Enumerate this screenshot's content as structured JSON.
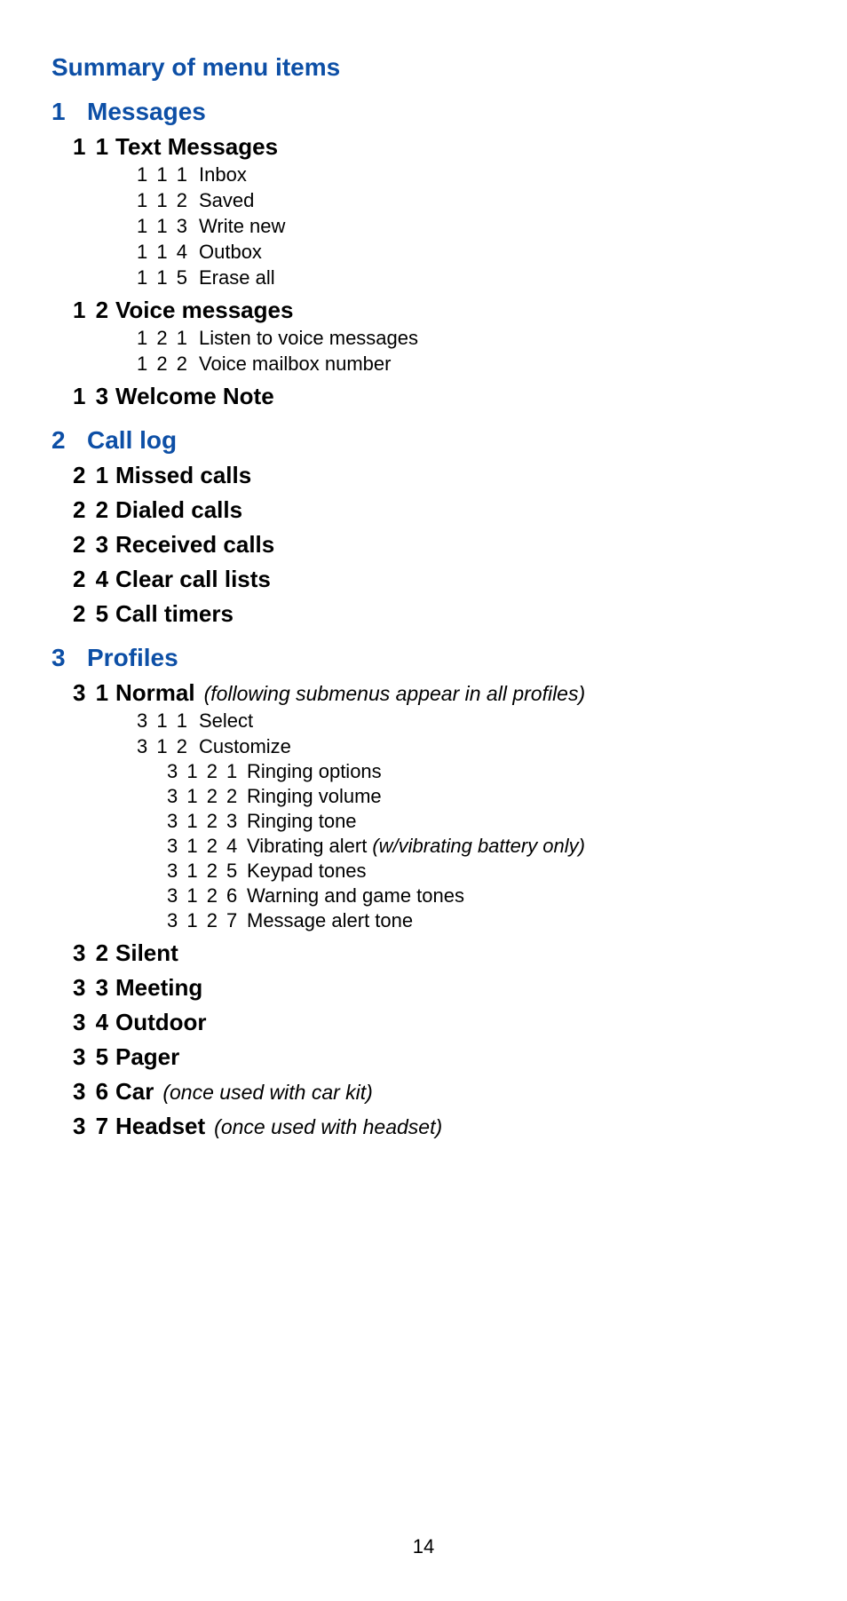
{
  "title": "Summary of menu items",
  "pageNumber": "14",
  "s1": {
    "n": "1",
    "t": "Messages"
  },
  "s1_1": {
    "n": "1 1",
    "t": "Text Messages"
  },
  "s1_1_1": {
    "n": "1 1 1",
    "t": "Inbox"
  },
  "s1_1_2": {
    "n": "1 1 2",
    "t": "Saved"
  },
  "s1_1_3": {
    "n": "1 1 3",
    "t": "Write new"
  },
  "s1_1_4": {
    "n": "1 1 4",
    "t": "Outbox"
  },
  "s1_1_5": {
    "n": "1 1 5",
    "t": "Erase all"
  },
  "s1_2": {
    "n": "1 2",
    "t": "Voice messages"
  },
  "s1_2_1": {
    "n": "1 2 1",
    "t": "Listen to voice messages"
  },
  "s1_2_2": {
    "n": "1 2 2",
    "t": "Voice mailbox number"
  },
  "s1_3": {
    "n": "1 3",
    "t": "Welcome Note"
  },
  "s2": {
    "n": "2",
    "t": "Call log"
  },
  "s2_1": {
    "n": "2 1",
    "t": "Missed calls"
  },
  "s2_2": {
    "n": "2 2",
    "t": "Dialed calls"
  },
  "s2_3": {
    "n": "2 3",
    "t": "Received calls"
  },
  "s2_4": {
    "n": "2 4",
    "t": "Clear call lists"
  },
  "s2_5": {
    "n": "2 5",
    "t": "Call timers"
  },
  "s3": {
    "n": "3",
    "t": "Profiles"
  },
  "s3_1": {
    "n": "3 1",
    "t": "Normal",
    "note": "(following submenus appear in all profiles)"
  },
  "s3_1_1": {
    "n": "3 1 1",
    "t": "Select"
  },
  "s3_1_2": {
    "n": "3 1 2",
    "t": "Customize"
  },
  "s3_1_2_1": {
    "n": "3 1 2 1",
    "t": "Ringing options"
  },
  "s3_1_2_2": {
    "n": "3 1 2 2",
    "t": "Ringing volume"
  },
  "s3_1_2_3": {
    "n": "3 1 2 3",
    "t": "Ringing tone"
  },
  "s3_1_2_4": {
    "n": "3 1 2 4",
    "t": "Vibrating alert",
    "note": "(w/vibrating battery only)"
  },
  "s3_1_2_5": {
    "n": "3 1 2 5",
    "t": "Keypad tones"
  },
  "s3_1_2_6": {
    "n": "3 1 2 6",
    "t": "Warning and game tones"
  },
  "s3_1_2_7": {
    "n": "3 1 2 7",
    "t": "Message alert tone"
  },
  "s3_2": {
    "n": "3 2",
    "t": "Silent"
  },
  "s3_3": {
    "n": "3 3",
    "t": "Meeting"
  },
  "s3_4": {
    "n": "3 4",
    "t": "Outdoor"
  },
  "s3_5": {
    "n": "3 5",
    "t": "Pager"
  },
  "s3_6": {
    "n": "3 6",
    "t": "Car",
    "note": "(once used with car kit)"
  },
  "s3_7": {
    "n": "3 7",
    "t": "Headset",
    "note": "(once used with headset)"
  }
}
